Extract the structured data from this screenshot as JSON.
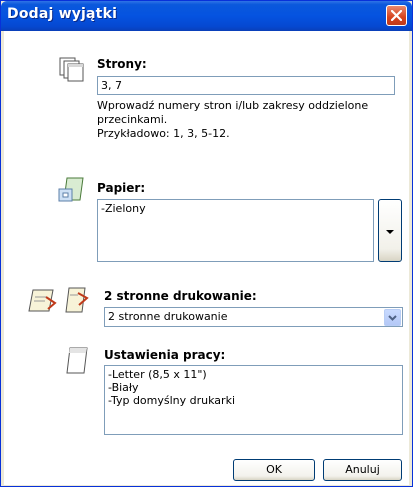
{
  "window": {
    "title": "Dodaj wyjątki"
  },
  "pages": {
    "label": "Strony:",
    "value": "3, 7",
    "hint": "Wprowadź numery stron i/lub zakresy oddzielone przecinkami.",
    "example": "Przykładowo: 1, 3, 5-12."
  },
  "paper": {
    "label": "Papier:",
    "value": "-Zielony"
  },
  "duplex": {
    "label": "2 stronne drukowanie:",
    "selected": "2 stronne drukowanie"
  },
  "job": {
    "label": "Ustawienia pracy:",
    "lines": [
      "-Letter (8,5 x 11\")",
      "-Biały",
      "-Typ domyślny drukarki"
    ]
  },
  "buttons": {
    "ok": "OK",
    "cancel": "Anuluj"
  },
  "colors": {
    "title_bar": "#0553e0",
    "close": "#d6431e",
    "border": "#7f9db9"
  },
  "icons": [
    "close-icon",
    "pages-icon",
    "paper-icon",
    "duplex-flip-long-icon",
    "duplex-flip-short-icon",
    "dropdown-arrow-icon",
    "job-settings-icon"
  ]
}
